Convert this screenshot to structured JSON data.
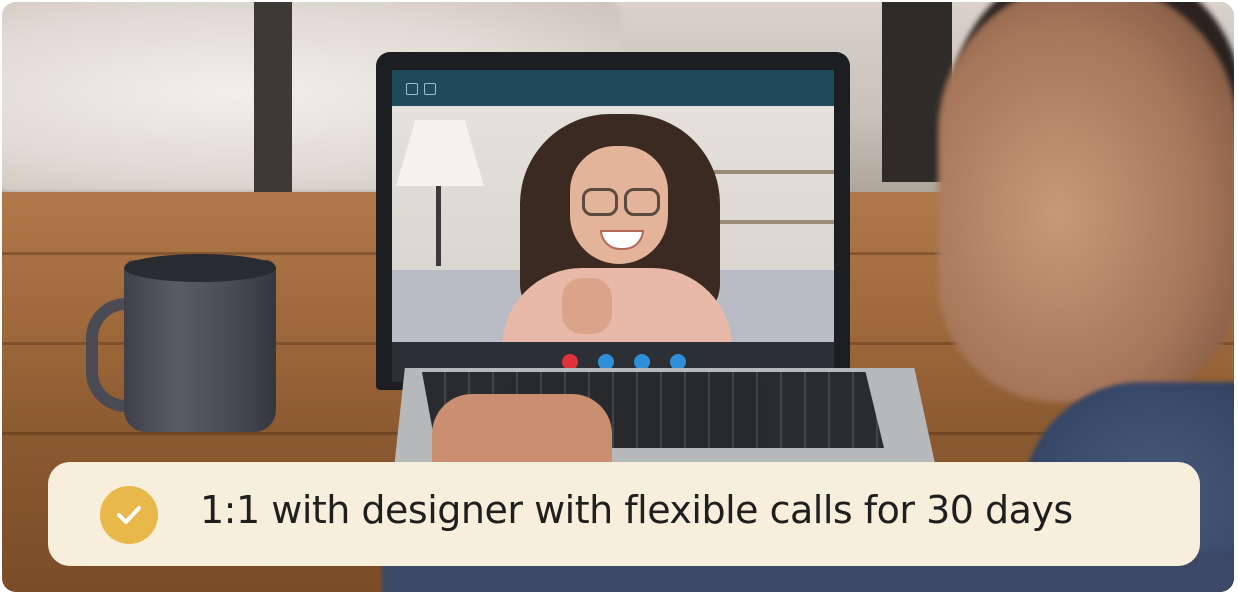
{
  "caption": {
    "text": "1:1 with designer with flexible calls for 30 days",
    "icon": "check-circle-icon",
    "icon_color": "#e8b84a",
    "background_color": "#f7eedb"
  },
  "scene": {
    "video_call_buttons": [
      "end-call-icon",
      "mic-icon",
      "video-icon",
      "share-icon"
    ],
    "video_call_button_colors": [
      "#e0323c",
      "#2f8fd8",
      "#2f8fd8",
      "#2f8fd8"
    ]
  }
}
